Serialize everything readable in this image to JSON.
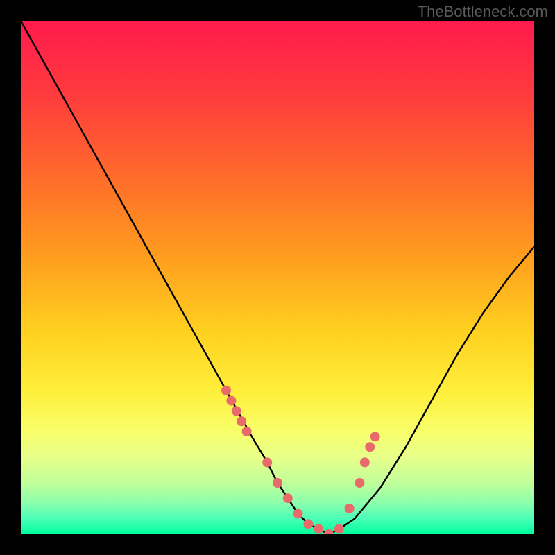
{
  "watermark": "TheBottleneck.com",
  "chart_data": {
    "type": "line",
    "title": "",
    "xlabel": "",
    "ylabel": "",
    "xlim": [
      0,
      100
    ],
    "ylim": [
      0,
      100
    ],
    "series": [
      {
        "name": "bottleneck-curve",
        "x": [
          0,
          5,
          10,
          15,
          20,
          25,
          30,
          35,
          40,
          45,
          48,
          50,
          52,
          54,
          56,
          58,
          60,
          62,
          65,
          70,
          75,
          80,
          85,
          90,
          95,
          100
        ],
        "y": [
          100,
          91,
          82,
          73,
          64,
          55,
          46,
          37,
          28,
          19,
          14,
          10,
          7,
          4,
          2,
          1,
          0,
          1,
          3,
          9,
          17,
          26,
          35,
          43,
          50,
          56
        ]
      }
    ],
    "highlight_points": {
      "name": "measured-samples",
      "x": [
        40,
        41,
        42,
        43,
        44,
        48,
        50,
        52,
        54,
        56,
        58,
        60,
        62,
        64,
        66,
        67,
        68,
        69
      ],
      "y": [
        28,
        26,
        24,
        22,
        20,
        14,
        10,
        7,
        4,
        2,
        1,
        0,
        1,
        5,
        10,
        14,
        17,
        19
      ]
    },
    "gradient_stops": [
      {
        "offset": 0.0,
        "color": "#ff1a4d"
      },
      {
        "offset": 0.15,
        "color": "#ff3d3d"
      },
      {
        "offset": 0.3,
        "color": "#ff6a2b"
      },
      {
        "offset": 0.45,
        "color": "#ff9a1f"
      },
      {
        "offset": 0.6,
        "color": "#ffcf1f"
      },
      {
        "offset": 0.72,
        "color": "#ffee3a"
      },
      {
        "offset": 0.8,
        "color": "#f8ff6a"
      },
      {
        "offset": 0.85,
        "color": "#e8ff8a"
      },
      {
        "offset": 0.9,
        "color": "#c0ff9a"
      },
      {
        "offset": 0.94,
        "color": "#8affac"
      },
      {
        "offset": 0.97,
        "color": "#4affb8"
      },
      {
        "offset": 1.0,
        "color": "#00ff9a"
      }
    ]
  }
}
